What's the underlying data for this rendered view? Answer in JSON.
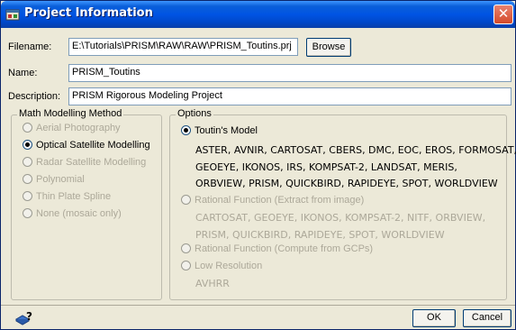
{
  "window": {
    "title": "Project Information",
    "close_glyph": "✕",
    "icon": "project-icon"
  },
  "filename": {
    "label": "Filename:",
    "value": "E:\\Tutorials\\PRISM\\RAW\\RAW\\PRISM_Toutins.prj",
    "browse_label": "Browse"
  },
  "name": {
    "label": "Name:",
    "value": "PRISM_Toutins"
  },
  "description": {
    "label": "Description:",
    "value": "PRISM Rigorous Modeling Project"
  },
  "math_method": {
    "title": "Math Modelling Method",
    "options": [
      {
        "label": "Aerial Photography",
        "selected": false,
        "enabled": false
      },
      {
        "label": "Optical Satellite Modelling",
        "selected": true,
        "enabled": true
      },
      {
        "label": "Radar Satellite Modelling",
        "selected": false,
        "enabled": false
      },
      {
        "label": "Polynomial",
        "selected": false,
        "enabled": false
      },
      {
        "label": "Thin Plate Spline",
        "selected": false,
        "enabled": false
      },
      {
        "label": "None (mosaic only)",
        "selected": false,
        "enabled": false
      }
    ]
  },
  "options": {
    "title": "Options",
    "toutin": {
      "label": "Toutin's Model",
      "selected": true,
      "enabled": true,
      "sensors": [
        "ASTER, AVNIR, CARTOSAT, CBERS, DMC, EOC, EROS, FORMOSAT,",
        "GEOEYE, IKONOS, IRS, KOMPSAT-2, LANDSAT, MERIS,",
        "ORBVIEW, PRISM, QUICKBIRD, RAPIDEYE, SPOT, WORLDVIEW"
      ]
    },
    "rational_extract": {
      "label": "Rational Function (Extract from image)",
      "selected": false,
      "enabled": false,
      "sensors": [
        "CARTOSAT, GEOEYE, IKONOS, KOMPSAT-2, NITF, ORBVIEW,",
        "PRISM, QUICKBIRD, RAPIDEYE, SPOT, WORLDVIEW"
      ]
    },
    "rational_gcp": {
      "label": "Rational Function (Compute from GCPs)",
      "selected": false,
      "enabled": false
    },
    "low_res": {
      "label": "Low Resolution",
      "selected": false,
      "enabled": false,
      "sensors": [
        "AVHRR"
      ]
    }
  },
  "footer": {
    "help_icon": "help-icon",
    "ok_label": "OK",
    "cancel_label": "Cancel"
  },
  "colors": {
    "title_bar": "#0054e3",
    "dialog_bg": "#ece9d8",
    "disabled_text": "#aca899"
  }
}
